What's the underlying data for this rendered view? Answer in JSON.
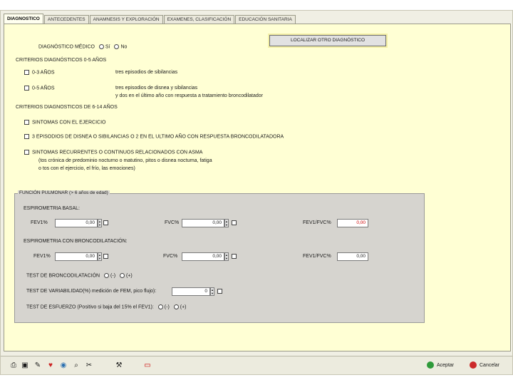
{
  "tabs": [
    {
      "label": "DIAGNOSTICO"
    },
    {
      "label": "ANTECEDENTES"
    },
    {
      "label": "ANAMNESIS Y EXPLORACIÓN"
    },
    {
      "label": "EXAMENES, CLASIFICACIÓN"
    },
    {
      "label": "EDUCACIÓN SANITARIA"
    }
  ],
  "top_button": {
    "label": "LOCALIZAR OTRO DIAGNÓSTICO"
  },
  "diagnostico": {
    "label": "DIAGNÓSTICO MÉDICO",
    "yes": "Sí",
    "no": "No"
  },
  "criterios_0_5": {
    "title": "CRITERIOS DIAGNÓSTICOS 0-5 AÑOS",
    "items": [
      {
        "label": "0-3 AÑOS",
        "desc": "tres episodios de sibilancias"
      },
      {
        "label": "0-5 AÑOS",
        "desc": "tres episodios de disnea y sibilancias",
        "desc2": "y dos en el último año con respuesta a tratamiento broncodilatador"
      }
    ]
  },
  "criterios_6_14": {
    "title": "CRITERIOS DIAGNOSTICOS DE 6-14 AÑOS",
    "items": [
      {
        "label": "SINTOMAS CON EL EJERCICIO"
      },
      {
        "label": "3 EPISODIOS DE DISNEA O SIBILANCIAS O 2 EN EL ULTIMO AÑO CON RESPUESTA BRONCODILATADORA"
      },
      {
        "label": "SINTOMAS RECURRENTES O CONTINUOS RELACIONADOS CON ASMA",
        "desc": "(tos crónica de predominio nocturno o matutino, pitos o disnea nocturna, fatiga",
        "desc2": "o tos con el ejercicio, el frío, las emociones)"
      }
    ]
  },
  "funcion_pulmonar": {
    "title": "FUNCIÓN PULMONAR (> 6 años de edad)",
    "espirometria_basal": "ESPIROMETRIA BASAL:",
    "fev1_label": "FEV1%",
    "fev1_value": "0,00",
    "fvc_label": "FVC%",
    "fvc_value": "0,00",
    "ratio_label": "FEV1/FVC%",
    "ratio_value": "0,00",
    "espirometria_bd": "ESPIROMETRIA CON BRONCODILATACIÓN:",
    "fev1_bd_value": "0,00",
    "fvc_bd_value": "0,00",
    "ratio_bd_value": "0,00",
    "test_bd": "TEST DE BRONCODILATACIÓN",
    "test_var": "TEST DE VARIABILIDAD(%) medición de FEM, pico flujo):",
    "test_var_value": "0",
    "test_esf": "TEST DE ESFUERZO (Positivo si baja del 15% el FEV1):",
    "neg": "(-)",
    "pos": "(+)"
  },
  "toolbar": {
    "accept": "Aceptar",
    "cancel": "Cancelar"
  }
}
